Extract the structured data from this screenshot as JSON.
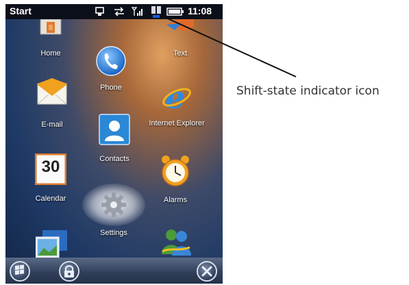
{
  "status_bar": {
    "title": "Start",
    "time": "11:08"
  },
  "tiles": [
    {
      "label": "Home",
      "icon": "home-icon"
    },
    {
      "label": "Text",
      "icon": "text-messaging-icon"
    },
    {
      "label": "Phone",
      "icon": "phone-icon"
    },
    {
      "label": "E-mail",
      "icon": "email-envelope-icon"
    },
    {
      "label": "Internet Explorer",
      "icon": "internet-explorer-icon"
    },
    {
      "label": "Contacts",
      "icon": "contacts-icon"
    },
    {
      "label": "Calendar",
      "icon": "calendar-icon",
      "day": "30"
    },
    {
      "label": "Alarms",
      "icon": "alarm-clock-icon"
    },
    {
      "label": "Settings",
      "icon": "settings-gear-icon"
    }
  ],
  "taskbar": {
    "buttons": [
      "windows-start-icon",
      "lock-icon",
      "close-icon"
    ]
  },
  "callout": {
    "label": "Shift-state indicator icon"
  }
}
